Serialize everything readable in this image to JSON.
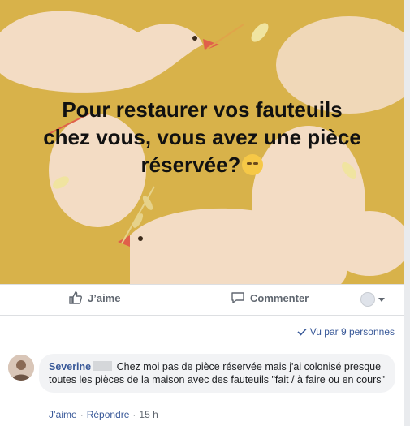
{
  "post": {
    "image_text_line1": "Pour restaurer vos fauteuils",
    "image_text_line2": "chez vous, vous avez une pièce",
    "image_text_line3": "réservée?",
    "emoji_icon": "rolling-eyes-emoji"
  },
  "actions": {
    "like_label": "J’aime",
    "comment_label": "Commenter"
  },
  "seen": {
    "text": "Vu par 9 personnes"
  },
  "comment": {
    "author": "Severine",
    "text": "Chez moi pas de pièce réservée mais j'ai colonisé presque toutes les pièces de la maison avec des fauteuils \"fait / à faire ou en cours\"",
    "like_label": "J’aime",
    "reply_label": "Répondre",
    "time": "15 h"
  },
  "colors": {
    "image_bg": "#d8b24a",
    "link": "#385898",
    "muted": "#606770"
  }
}
